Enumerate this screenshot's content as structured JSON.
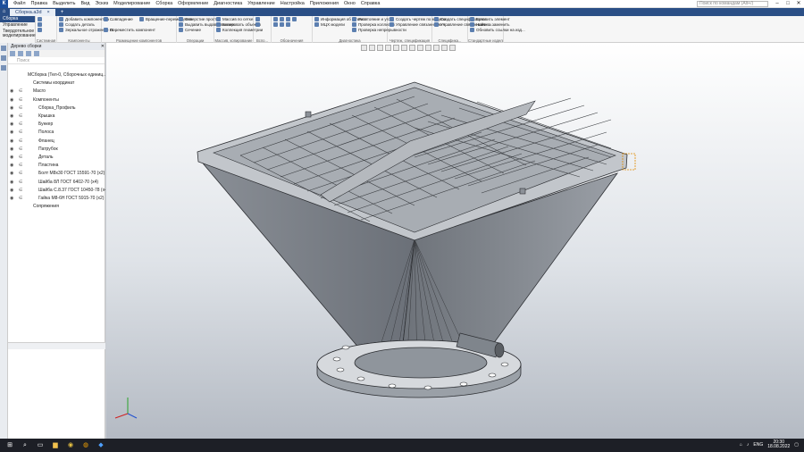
{
  "menu": [
    "Файл",
    "Правка",
    "Выделить",
    "Вид",
    "Эскиз",
    "Моделирование",
    "Сборка",
    "Оформление",
    "Диагностика",
    "Управление",
    "Настройка",
    "Приложения",
    "Окно",
    "Справка"
  ],
  "search_placeholder": "Поиск по командам (Alt+/)",
  "document_tab": "Сборка.a3d",
  "modes": [
    "Сборка",
    "Управление",
    "Твердотельное моделирование"
  ],
  "ribbon": {
    "groups": [
      {
        "caption": "Системная",
        "buttons": []
      },
      {
        "caption": "Компоненты",
        "buttons": [
          "Добавить компонент из ...",
          "Создать деталь",
          "Зеркальное отражение ко..."
        ]
      },
      {
        "caption": "Размещение компонентов",
        "buttons": [
          "Совпадение",
          "Вращение-перемещение",
          "Переместить компонент"
        ]
      },
      {
        "caption": "Операции",
        "buttons": [
          "Отверстие простое",
          "Выдавить выдавливанием",
          "Сечение"
        ]
      },
      {
        "caption": "Массив, копирование",
        "buttons": [
          "Массив по сетке",
          "Копировать объекты",
          "Коллекция геометрии"
        ]
      },
      {
        "caption": "Вспо...",
        "buttons": []
      },
      {
        "caption": "Обозначения",
        "buttons": []
      },
      {
        "caption": "Диагностика",
        "buttons": [
          "Информация об объекте",
          "МЦХ модели",
          "Расстояние и угол",
          "Проверка коллизий",
          "Проверка непрерывности"
        ]
      },
      {
        "caption": "Чертеж, спецификация",
        "buttons": [
          "Создать чертеж по модели",
          "Управление связанными ч..."
        ]
      },
      {
        "caption": "Специфика...",
        "buttons": [
          "Создать спецификацию",
          "Управление связанными с..."
        ]
      },
      {
        "caption": "Стандартные изделия",
        "buttons": [
          "Вставить элемент",
          "Найти и заменить",
          "Обновить ссылки на изд..."
        ]
      }
    ]
  },
  "tree": {
    "header": "Дерево сборки",
    "filter_placeholder": "Поиск",
    "items": [
      {
        "label": "МСборка (Тел-0, Сборочных единиц...",
        "indent": 0,
        "eye": false
      },
      {
        "label": "Системы координат",
        "indent": 1,
        "eye": false
      },
      {
        "label": "Macro",
        "indent": 1,
        "eye": true
      },
      {
        "label": "Компоненты",
        "indent": 1,
        "eye": true
      },
      {
        "label": "Сборка_Профиль",
        "indent": 2,
        "eye": true
      },
      {
        "label": "Крышка",
        "indent": 2,
        "eye": true
      },
      {
        "label": "Бункер",
        "indent": 2,
        "eye": true
      },
      {
        "label": "Полоса",
        "indent": 2,
        "eye": true
      },
      {
        "label": "Фланец",
        "indent": 2,
        "eye": true
      },
      {
        "label": "Патрубок",
        "indent": 2,
        "eye": true
      },
      {
        "label": "Деталь",
        "indent": 2,
        "eye": true
      },
      {
        "label": "Пластина",
        "indent": 2,
        "eye": true
      },
      {
        "label": "Болт M8х30 ГОСТ 15591-70 (x2)",
        "indent": 2,
        "eye": true
      },
      {
        "label": "Шайба 8Л ГОСТ 6402-70 (x4)",
        "indent": 2,
        "eye": true
      },
      {
        "label": "Шайба С.8.37 ГОСТ 10450-78 (x4)",
        "indent": 2,
        "eye": true
      },
      {
        "label": "Гайка М8-6Н ГОСТ 5915-70 (x2)",
        "indent": 2,
        "eye": true
      },
      {
        "label": "Сопряжения",
        "indent": 1,
        "eye": false
      }
    ]
  },
  "taskbar": {
    "lang": "ENG",
    "time": "20:30",
    "date": "18.08.2022"
  },
  "colors": {
    "accent": "#2b4f86",
    "taskbar": "#1d1f26"
  }
}
